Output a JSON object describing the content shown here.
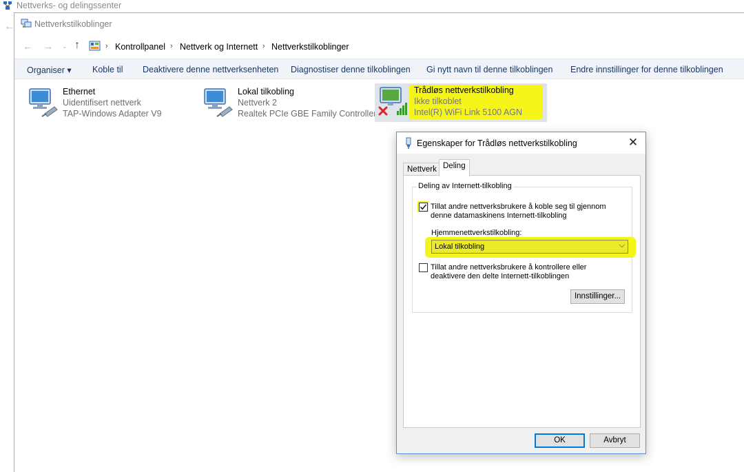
{
  "background_window": {
    "title": "Nettverks- og delingssenter"
  },
  "window": {
    "title": "Nettverkstilkoblinger",
    "breadcrumbs": [
      "Kontrollpanel",
      "Nettverk og Internett",
      "Nettverkstilkoblinger"
    ]
  },
  "toolbar": {
    "organise": "Organiser ▾",
    "connect": "Koble til",
    "disable": "Deaktivere denne nettverksenheten",
    "diagnose": "Diagnostiser denne tilkoblingen",
    "rename": "Gi nytt navn til denne tilkoblingen",
    "change_settings": "Endre innstillinger for denne tilkoblingen"
  },
  "connections": [
    {
      "name": "Ethernet",
      "status": "Uidentifisert nettverk",
      "device": "TAP-Windows Adapter V9"
    },
    {
      "name": "Lokal tilkobling",
      "status": "Nettverk  2",
      "device": "Realtek PCIe GBE Family Controller"
    },
    {
      "name": "Trådløs nettverkstilkobling",
      "status": "Ikke tilkoblet",
      "device": "Intel(R) WiFi Link 5100 AGN"
    }
  ],
  "dialog": {
    "title": "Egenskaper for Trådløs nettverkstilkobling",
    "tabs": [
      "Nettverk",
      "Deling"
    ],
    "active_tab": "Deling",
    "group_label": "Deling av Internett-tilkobling",
    "allow_connect_line1": "Tillat andre nettverksbrukere å koble seg til gjennom",
    "allow_connect_line2": "denne datamaskinens Internett-tilkobling",
    "allow_connect_checked": true,
    "home_label": "Hjemmenettverkstilkobling:",
    "home_value": "Lokal tilkobling",
    "allow_control_line1": "Tillat andre nettverksbrukere å kontrollere eller",
    "allow_control_line2": "deaktivere den delte Internett-tilkoblingen",
    "allow_control_checked": false,
    "settings_button": "Innstillinger...",
    "ok_button": "OK",
    "cancel_button": "Avbryt"
  },
  "colors": {
    "highlight": "#f5f51a",
    "toolbar_text": "#1a3664",
    "accent": "#0078d7"
  }
}
